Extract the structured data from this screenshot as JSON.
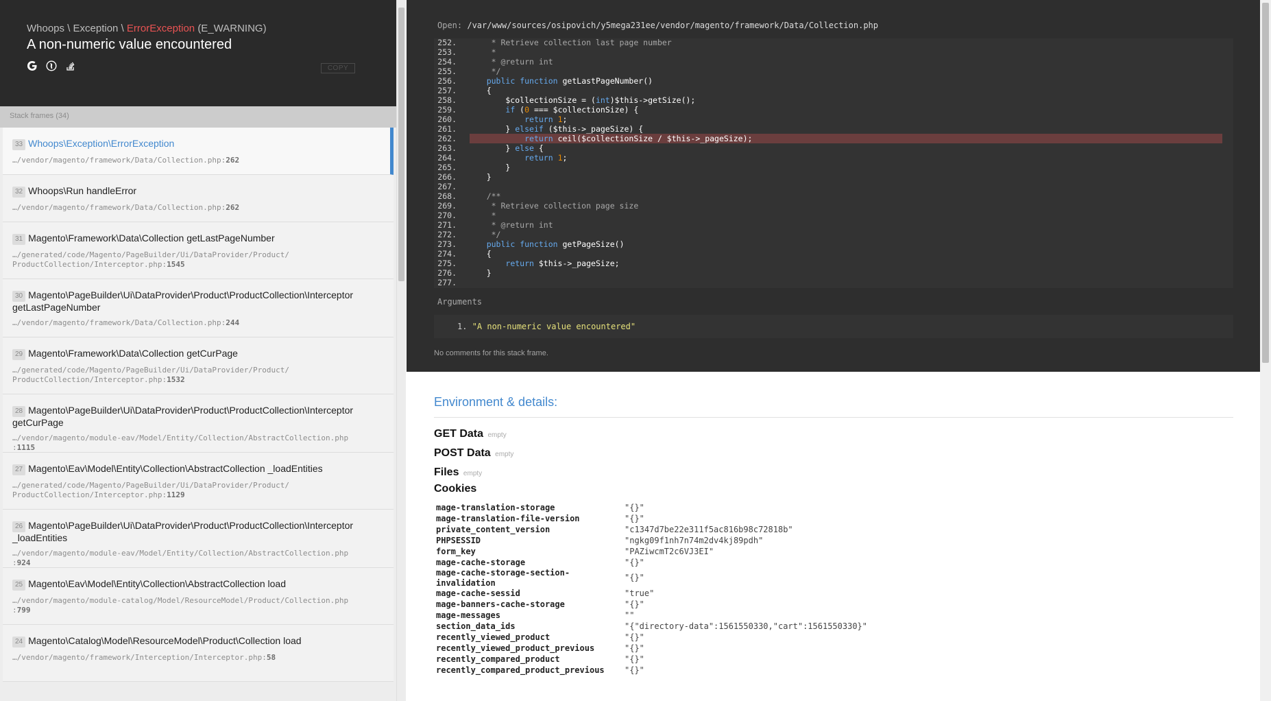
{
  "exception": {
    "class_prefix": "Whoops \\ Exception \\",
    "class_name": "ErrorException",
    "class_suffix": "(E_WARNING)",
    "message": "A non-numeric value encountered",
    "icons": [
      "google-icon",
      "duckduckgo-icon",
      "stackoverflow-icon"
    ],
    "copy_label": "COPY"
  },
  "frames": {
    "header": "Stack frames (34)",
    "items": [
      {
        "index": "33",
        "cls": "Whoops\\Exception\\ErrorException",
        "path": "…/vendor/magento/framework/Data/Collection.php",
        "line": "262"
      },
      {
        "index": "32",
        "cls": "Whoops\\Run handleError",
        "path": "…/vendor/magento/framework/Data/Collection.php",
        "line": "262"
      },
      {
        "index": "31",
        "cls": "Magento\\Framework\\Data\\Collection getLastPageNumber",
        "path": "…/generated/code/Magento/PageBuilder/Ui/DataProvider/Product/\nProductCollection/Interceptor.php",
        "line": "1545"
      },
      {
        "index": "30",
        "cls": "Magento\\PageBuilder\\Ui\\DataProvider\\Product\\ProductCollection\\Interceptor getLastPageNumber",
        "path": "…/vendor/magento/framework/Data/Collection.php",
        "line": "244"
      },
      {
        "index": "29",
        "cls": "Magento\\Framework\\Data\\Collection getCurPage",
        "path": "…/generated/code/Magento/PageBuilder/Ui/DataProvider/Product/\nProductCollection/Interceptor.php",
        "line": "1532"
      },
      {
        "index": "28",
        "cls": "Magento\\PageBuilder\\Ui\\DataProvider\\Product\\ProductCollection\\Interceptor getCurPage",
        "path": "…/vendor/magento/module-eav/Model/Entity/Collection/AbstractCollection.php\n",
        "line": "1115"
      },
      {
        "index": "27",
        "cls": "Magento\\Eav\\Model\\Entity\\Collection\\AbstractCollection _loadEntities",
        "path": "…/generated/code/Magento/PageBuilder/Ui/DataProvider/Product/\nProductCollection/Interceptor.php",
        "line": "1129"
      },
      {
        "index": "26",
        "cls": "Magento\\PageBuilder\\Ui\\DataProvider\\Product\\ProductCollection\\Interceptor _loadEntities",
        "path": "…/vendor/magento/module-eav/Model/Entity/Collection/AbstractCollection.php\n",
        "line": "924"
      },
      {
        "index": "25",
        "cls": "Magento\\Eav\\Model\\Entity\\Collection\\AbstractCollection load",
        "path": "…/vendor/magento/module-catalog/Model/ResourceModel/Product/Collection.php\n",
        "line": "799"
      },
      {
        "index": "24",
        "cls": "Magento\\Catalog\\Model\\ResourceModel\\Product\\Collection load",
        "path": "…/vendor/magento/framework/Interception/Interceptor.php",
        "line": "58"
      }
    ]
  },
  "code": {
    "open_label": "Open:",
    "file_path": "/var/www/sources/osipovich/y5mega231ee/vendor/magento/framework/Data/Collection.php",
    "highlight_line": "262",
    "lines": [
      {
        "n": "252.",
        "text": "     * Retrieve collection last page number",
        "kind": "cm"
      },
      {
        "n": "253.",
        "text": "     *",
        "kind": "cm"
      },
      {
        "n": "254.",
        "text": "     * @return int",
        "kind": "cm"
      },
      {
        "n": "255.",
        "text": "     */",
        "kind": "cm"
      },
      {
        "n": "256.",
        "text": "    public function getLastPageNumber()",
        "kind": "decl"
      },
      {
        "n": "257.",
        "text": "    {",
        "kind": "plain"
      },
      {
        "n": "258.",
        "text": "        $collectionSize = (int)$this->getSize();",
        "kind": "cast"
      },
      {
        "n": "259.",
        "text": "        if (0 === $collectionSize) {",
        "kind": "if0"
      },
      {
        "n": "260.",
        "text": "            return 1;",
        "kind": "ret1"
      },
      {
        "n": "261.",
        "text": "        } elseif ($this->_pageSize) {",
        "kind": "plain"
      },
      {
        "n": "262.",
        "text": "            return ceil($collectionSize / $this->_pageSize);",
        "kind": "retceil"
      },
      {
        "n": "263.",
        "text": "        } else {",
        "kind": "plain"
      },
      {
        "n": "264.",
        "text": "            return 1;",
        "kind": "ret1"
      },
      {
        "n": "265.",
        "text": "        }",
        "kind": "plain"
      },
      {
        "n": "266.",
        "text": "    }",
        "kind": "plain"
      },
      {
        "n": "267.",
        "text": "",
        "kind": "plain"
      },
      {
        "n": "268.",
        "text": "    /**",
        "kind": "cm"
      },
      {
        "n": "269.",
        "text": "     * Retrieve collection page size",
        "kind": "cm"
      },
      {
        "n": "270.",
        "text": "     *",
        "kind": "cm"
      },
      {
        "n": "271.",
        "text": "     * @return int",
        "kind": "cm"
      },
      {
        "n": "272.",
        "text": "     */",
        "kind": "cm"
      },
      {
        "n": "273.",
        "text": "    public function getPageSize()",
        "kind": "decl"
      },
      {
        "n": "274.",
        "text": "    {",
        "kind": "plain"
      },
      {
        "n": "275.",
        "text": "        return $this->_pageSize;",
        "kind": "retplain"
      },
      {
        "n": "276.",
        "text": "    }",
        "kind": "plain"
      },
      {
        "n": "277.",
        "text": "",
        "kind": "plain"
      }
    ]
  },
  "arguments": {
    "label": "Arguments",
    "items": [
      {
        "index": "1.",
        "value": "\"A non-numeric value encountered\""
      }
    ]
  },
  "no_comments": "No comments for this stack frame.",
  "environment": {
    "title": "Environment & details:",
    "get_label": "GET Data",
    "post_label": "POST Data",
    "files_label": "Files",
    "empty_label": "empty",
    "cookies_label": "Cookies",
    "cookies": [
      {
        "key": "mage-translation-storage",
        "value": "\"{}\""
      },
      {
        "key": "mage-translation-file-version",
        "value": "\"{}\""
      },
      {
        "key": "private_content_version",
        "value": "\"c1347d7be22e311f5ac816b98c72818b\""
      },
      {
        "key": "PHPSESSID",
        "value": "\"ngkg09f1nh7n74m2dv4kj89pdh\""
      },
      {
        "key": "form_key",
        "value": "\"PAZiwcmT2c6VJ3EI\""
      },
      {
        "key": "mage-cache-storage",
        "value": "\"{}\""
      },
      {
        "key": "mage-cache-storage-section-\ninvalidation",
        "value": "\"{}\""
      },
      {
        "key": "mage-cache-sessid",
        "value": "\"true\""
      },
      {
        "key": "mage-banners-cache-storage",
        "value": "\"{}\""
      },
      {
        "key": "mage-messages",
        "value": "\"\""
      },
      {
        "key": "section_data_ids",
        "value": "\"{\"directory-data\":1561550330,\"cart\":1561550330}\""
      },
      {
        "key": "recently_viewed_product",
        "value": "\"{}\""
      },
      {
        "key": "recently_viewed_product_previous",
        "value": "\"{}\""
      },
      {
        "key": "recently_compared_product",
        "value": "\"{}\""
      },
      {
        "key": "recently_compared_product_previous",
        "value": "\"{}\""
      }
    ]
  },
  "colors": {
    "accent": "#4288ce",
    "error": "#e95353",
    "dark_bg": "#2e2e2e",
    "highlight": "#6b3e3e"
  }
}
